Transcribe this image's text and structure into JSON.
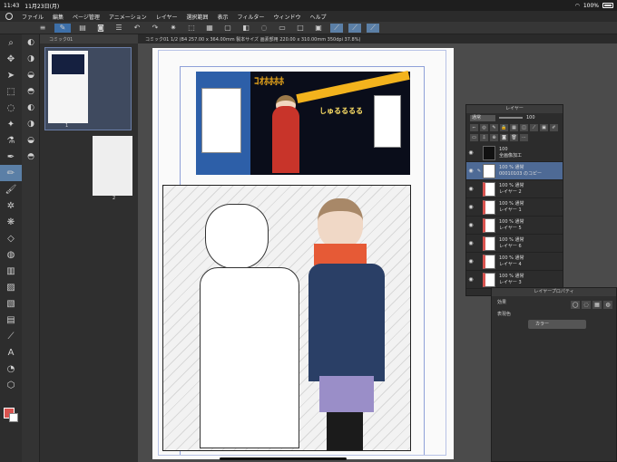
{
  "status": {
    "time": "11:43",
    "date": "11月23日(月)",
    "battery": "100%"
  },
  "menu": [
    "ファイル",
    "編集",
    "ページ管理",
    "アニメーション",
    "レイヤー",
    "選択範囲",
    "表示",
    "フィルター",
    "ウィンドウ",
    "ヘルプ"
  ],
  "page_panel": {
    "tab": "コミック01",
    "pages": [
      "1",
      "2"
    ]
  },
  "canvas": {
    "tab": "コミック01 1/2 (B4 257.00 x 364.00mm 製本サイズ 画素部用 220.00 x 310.00mm 350dpi 37.8%)",
    "panel1_title": "ｺｵﾎﾎﾎﾎ",
    "panel1_sub": "しゅるるるる"
  },
  "layer_panel": {
    "title": "レイヤー",
    "blend": "通常",
    "opacity": "100",
    "layers": [
      {
        "top": "100",
        "bottom": "全画像加工"
      },
      {
        "top": "100 % 通常",
        "bottom": "00010103 のコピー"
      },
      {
        "top": "100 % 通常",
        "bottom": "レイヤー 2"
      },
      {
        "top": "100 % 通常",
        "bottom": "レイヤー 1"
      },
      {
        "top": "100 % 通常",
        "bottom": "レイヤー 5"
      },
      {
        "top": "100 % 通常",
        "bottom": "レイヤー 6"
      },
      {
        "top": "100 % 通常",
        "bottom": "レイヤー 4"
      },
      {
        "top": "100 % 通常",
        "bottom": "レイヤー 3"
      }
    ]
  },
  "property_panel": {
    "title": "レイヤープロパティ",
    "effect_label": "効果",
    "color_label": "表現色",
    "color_value": "カラー"
  }
}
